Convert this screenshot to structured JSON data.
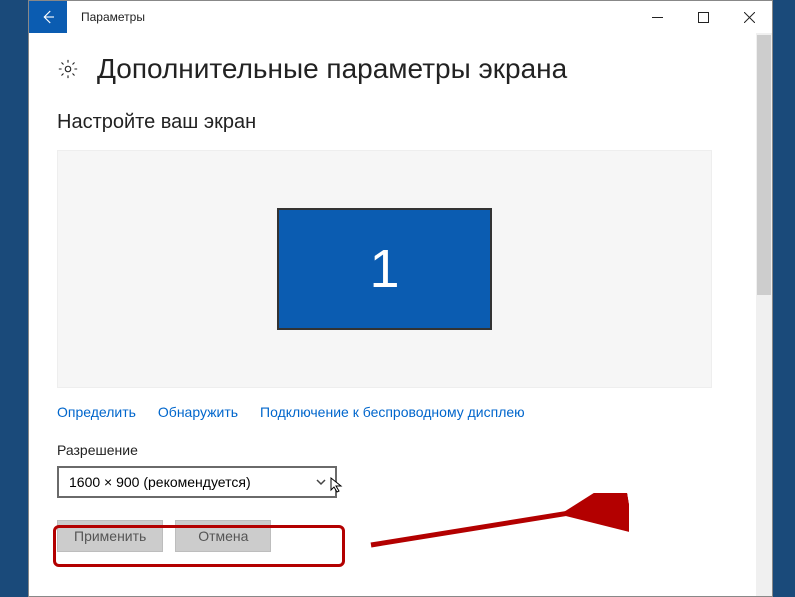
{
  "window": {
    "title": "Параметры"
  },
  "page": {
    "title": "Дополнительные параметры экрана"
  },
  "section": {
    "heading": "Настройте ваш экран"
  },
  "display": {
    "monitor_number": "1"
  },
  "links": {
    "identify": "Определить",
    "detect": "Обнаружить",
    "wireless": "Подключение к беспроводному дисплею"
  },
  "resolution": {
    "label": "Разрешение",
    "selected": "1600 × 900 (рекомендуется)"
  },
  "buttons": {
    "apply": "Применить",
    "cancel": "Отмена"
  }
}
